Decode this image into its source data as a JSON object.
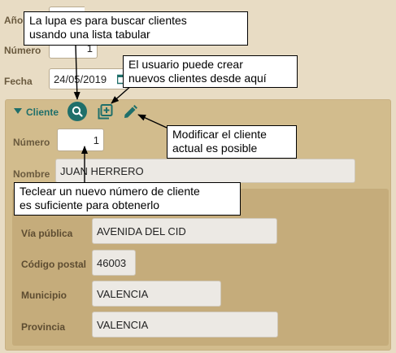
{
  "header": {
    "year_label": "Año",
    "number_label": "Número",
    "number_value": "1",
    "date_label": "Fecha",
    "date_value": "24/05/2019"
  },
  "client": {
    "section_label": "Cliente",
    "number_label": "Número",
    "number_value": "1",
    "name_label": "Nombre",
    "name_value": "JUAN HERRERO"
  },
  "address": {
    "street_label": "Vía pública",
    "street_value": "AVENIDA DEL CID",
    "postal_label": "Código postal",
    "postal_value": "46003",
    "city_label": "Municipio",
    "city_value": "VALENCIA",
    "province_label": "Provincia",
    "province_value": "VALENCIA"
  },
  "callouts": {
    "search": "La lupa es para buscar clientes\nusando una lista tabular",
    "create": "El usuario puede crear\nnuevos clientes desde aquí",
    "edit": "Modificar el cliente\nactual es posible",
    "type": "Teclear un nuevo número de cliente\nes suficiente para obtenerlo"
  },
  "colors": {
    "accent": "#1f6f6a",
    "panel": "#d2bc8d",
    "inner_panel": "#c5ac7b"
  }
}
